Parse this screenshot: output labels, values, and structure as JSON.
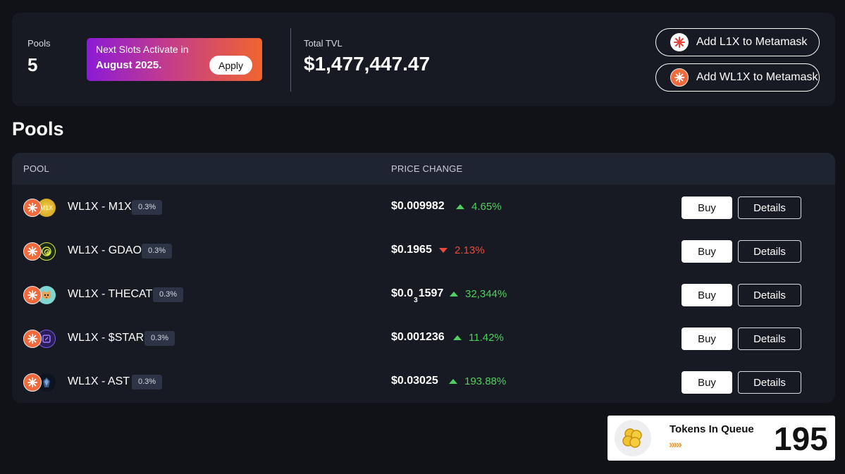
{
  "stats": {
    "pools_label": "Pools",
    "pools_value": "5",
    "promo_line1": "Next Slots Activate in",
    "promo_line2": "August 2025.",
    "apply_label": "Apply",
    "tvl_label": "Total TVL",
    "tvl_value": "$1,477,447.47"
  },
  "metamask": {
    "add_l1x": "Add L1X to Metamask",
    "add_wl1x": "Add WL1X to Metamask"
  },
  "section_title": "Pools",
  "table": {
    "headers": {
      "pool": "POOL",
      "price_change": "PRICE CHANGE"
    },
    "buy_label": "Buy",
    "details_label": "Details",
    "rows": [
      {
        "name": "WL1X - M1X",
        "fee": "0.3%",
        "price": "$0.009982",
        "change": "4.65%",
        "direction": "up",
        "token_icon": "m1x-token-icon"
      },
      {
        "name": "WL1X - GDAO",
        "fee": "0.3%",
        "price": "$0.1965",
        "change": "2.13%",
        "direction": "down",
        "token_icon": "gdao-token-icon"
      },
      {
        "name": "WL1X - THECAT",
        "fee": "0.3%",
        "price_prefix": "$0.0",
        "price_sub": "3",
        "price_suffix": "1597",
        "change": "32,344%",
        "direction": "up",
        "token_icon": "thecat-token-icon"
      },
      {
        "name": "WL1X - $STAR",
        "fee": "0.3%",
        "price": "$0.001236",
        "change": "11.42%",
        "direction": "up",
        "token_icon": "star-token-icon"
      },
      {
        "name": "WL1X - AST",
        "fee": "0.3%",
        "price": "$0.03025",
        "change": "193.88%",
        "direction": "up",
        "token_icon": "ast-token-icon"
      }
    ]
  },
  "queue": {
    "label": "Tokens In Queue",
    "arrows": "›››››",
    "count": "195"
  },
  "colors": {
    "background": "#101218",
    "card": "#171a22",
    "positive": "#4fd05f",
    "negative": "#ea4a3e",
    "l1x_brand": "#f26a3b"
  }
}
